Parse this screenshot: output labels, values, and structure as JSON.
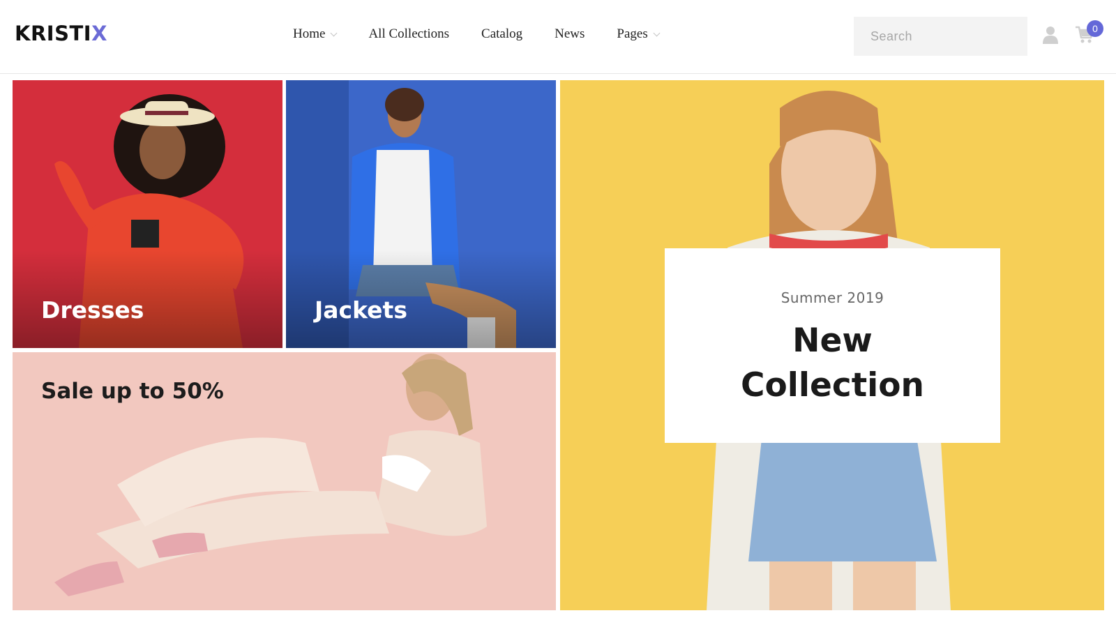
{
  "header": {
    "logo_main": "KRISTI",
    "logo_accent": "X",
    "nav": [
      {
        "label": "Home"
      },
      {
        "label": "All Collections"
      },
      {
        "label": "Catalog"
      },
      {
        "label": "News"
      },
      {
        "label": "Pages"
      }
    ],
    "search_placeholder": "Search",
    "cart_count": "0"
  },
  "tiles": {
    "dresses": {
      "label": "Dresses"
    },
    "jackets": {
      "label": "Jackets"
    },
    "sale": {
      "label": "Sale up to 50%"
    },
    "new_collection": {
      "subtitle": "Summer 2019",
      "title_line1": "New",
      "title_line2": "Collection"
    }
  },
  "icons": [
    "user-icon",
    "cart-icon",
    "chevron-down-icon"
  ],
  "colors": {
    "accent": "#6468d8",
    "dresses_bg": "#d42e3c",
    "jackets_bg": "#3c67c9",
    "sale_bg": "#f2c8bf",
    "new_collection_bg": "#f6cf57"
  }
}
